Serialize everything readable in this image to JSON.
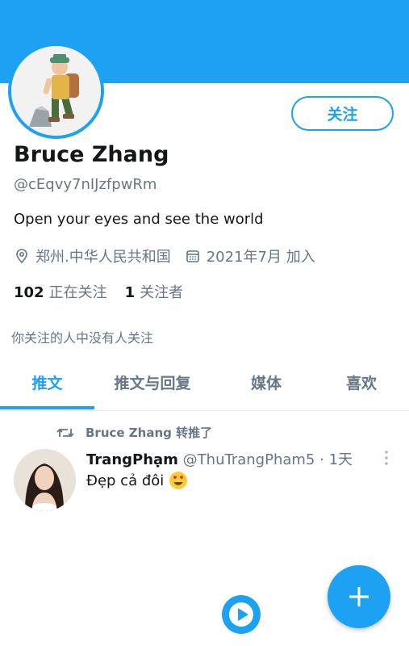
{
  "profile": {
    "name": "Bruce Zhang",
    "handle": "@cEqvy7nIJzfpwRm",
    "bio": "Open your eyes and see the world",
    "location": "郑州.中华人民共和国",
    "joined": "2021年7月 加入",
    "following_count": "102",
    "following_label": "正在关注",
    "followers_count": "1",
    "followers_label": "关注者",
    "followed_by_note": "你关注的人中没有人关注",
    "follow_button": "关注"
  },
  "tabs": [
    {
      "label": "推文",
      "active": true
    },
    {
      "label": "推文与回复",
      "active": false
    },
    {
      "label": "媒体",
      "active": false
    },
    {
      "label": "喜欢",
      "active": false
    }
  ],
  "feed": [
    {
      "retweeted_by": "Bruce Zhang 转推了",
      "author_name": "TrangPhạm",
      "author_handle": "@ThuTrangPham5",
      "time": "· 1天",
      "text": "Đẹp cả đôi",
      "emoji": "smiling-face-with-heart-eyes"
    }
  ],
  "icons": {
    "location": "location-pin-icon",
    "calendar": "calendar-icon",
    "retweet": "retweet-icon",
    "more": "more-vertical-icon",
    "play": "play-icon",
    "compose": "plus-icon"
  },
  "colors": {
    "accent": "#1da1f2",
    "text_primary": "#14171a",
    "text_secondary": "#657786"
  }
}
